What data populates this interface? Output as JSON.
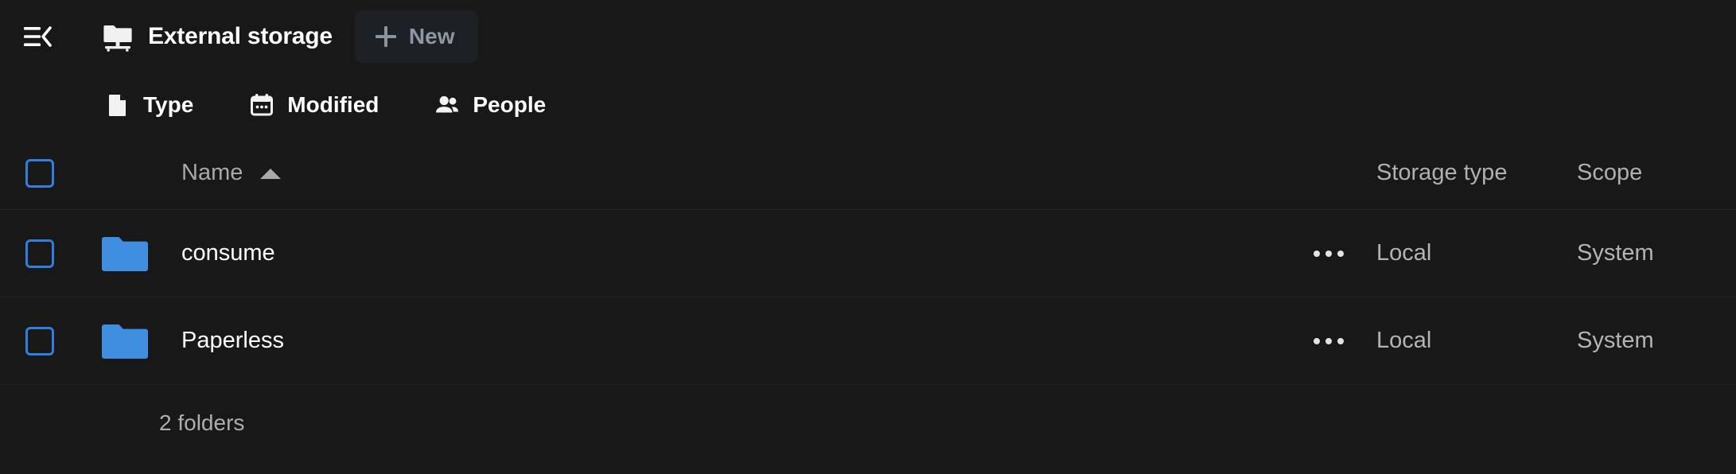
{
  "header": {
    "collapse_icon": "sidebar-collapse-icon",
    "storage_icon": "external-storage-folder-icon",
    "title": "External storage",
    "new_button": {
      "label": "New",
      "icon": "plus-icon"
    }
  },
  "filters": [
    {
      "label": "Type",
      "icon": "file-icon"
    },
    {
      "label": "Modified",
      "icon": "calendar-icon"
    },
    {
      "label": "People",
      "icon": "people-icon"
    }
  ],
  "table": {
    "select_all_checkbox": "unchecked",
    "columns": {
      "name": "Name",
      "sort_direction": "ascending",
      "storage_type": "Storage type",
      "scope": "Scope"
    },
    "rows": [
      {
        "name": "consume",
        "icon": "folder-icon",
        "checkbox": "unchecked",
        "actions_icon": "more-actions-icon",
        "storage_type": "Local",
        "scope": "System"
      },
      {
        "name": "Paperless",
        "icon": "folder-icon",
        "checkbox": "unchecked",
        "actions_icon": "more-actions-icon",
        "storage_type": "Local",
        "scope": "System"
      }
    ]
  },
  "footer": {
    "summary": "2 folders"
  },
  "colors": {
    "background": "#181818",
    "accent_blue": "#3b8ae8",
    "folder_blue": "#3f8ee0",
    "checkbox_blue": "#2f7fe0",
    "muted_text": "#a8a8a8",
    "new_button_text": "#8e97a3",
    "divider": "#262626"
  }
}
